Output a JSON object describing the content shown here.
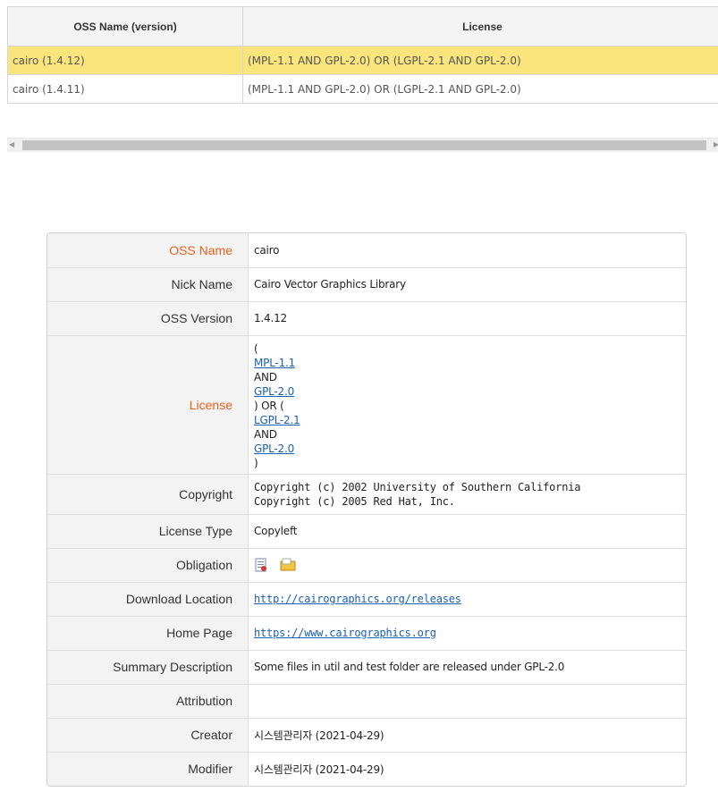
{
  "list": {
    "headers": [
      "OSS Name (version)",
      "License"
    ],
    "rows": [
      {
        "name": "cairo (1.4.12)",
        "license": "(MPL-1.1 AND GPL-2.0) OR (LGPL-2.1 AND GPL-2.0)",
        "selected": true
      },
      {
        "name": "cairo (1.4.11)",
        "license": "(MPL-1.1 AND GPL-2.0) OR (LGPL-2.1 AND GPL-2.0)",
        "selected": false
      }
    ]
  },
  "detail": {
    "oss_name": {
      "label": "OSS Name",
      "value": "cairo"
    },
    "nick_name": {
      "label": "Nick Name",
      "value": "Cairo Vector Graphics Library"
    },
    "oss_version": {
      "label": "OSS Version",
      "value": "1.4.12"
    },
    "license": {
      "label": "License",
      "lines": [
        "(",
        "MPL-1.1",
        "AND",
        "GPL-2.0",
        ") OR (",
        "LGPL-2.1",
        "AND",
        "GPL-2.0",
        ")"
      ]
    },
    "copyright": {
      "label": "Copyright",
      "lines": [
        "Copyright (c) 2002 University of Southern California",
        "Copyright (c) 2005 Red Hat, Inc."
      ]
    },
    "license_type": {
      "label": "License Type",
      "value": "Copyleft"
    },
    "obligation": {
      "label": "Obligation",
      "icons": [
        "notice-document-icon",
        "source-folder-icon"
      ]
    },
    "download_location": {
      "label": "Download Location",
      "value": "http://cairographics.org/releases"
    },
    "home_page": {
      "label": "Home Page",
      "value": "https://www.cairographics.org"
    },
    "summary_description": {
      "label": "Summary Description",
      "value": "Some files in util and test folder are released under GPL-2.0"
    },
    "attribution": {
      "label": "Attribution",
      "value": ""
    },
    "creator": {
      "label": "Creator",
      "value": "시스템관리자 (2021-04-29)"
    },
    "modifier": {
      "label": "Modifier",
      "value": "시스템관리자 (2021-04-29)"
    }
  },
  "colors": {
    "required_label": "#e8601c",
    "selected_row": "#f9e57c",
    "link": "#1a5fb4"
  }
}
